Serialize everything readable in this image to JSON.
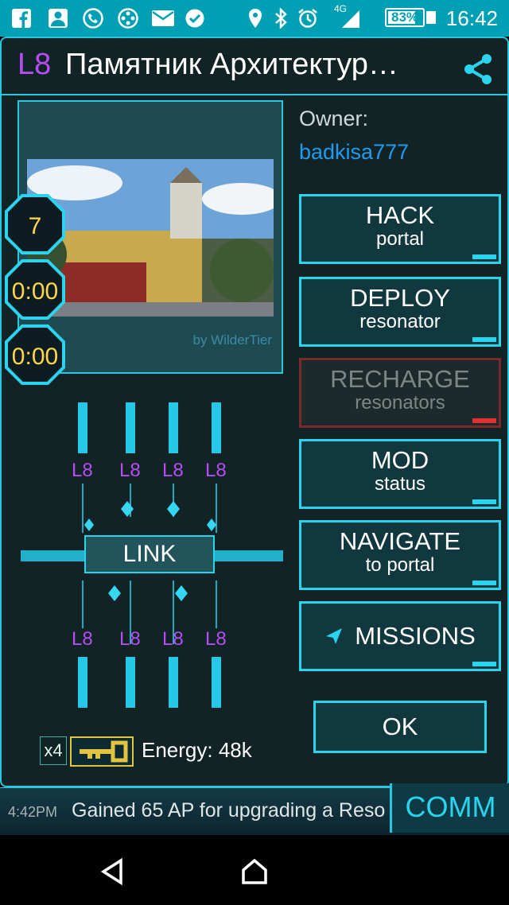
{
  "status_bar": {
    "time": "16:42",
    "battery": "83%",
    "battery_level_percent": 83,
    "network": "4G",
    "icons": [
      "facebook-icon",
      "person-icon",
      "phone-icon",
      "film-icon",
      "mail-icon",
      "check-icon",
      "location-icon",
      "bluetooth-icon",
      "alarm-icon",
      "signal-icon",
      "battery-icon"
    ]
  },
  "portal": {
    "level": "L8",
    "title": "Памятник Архитектур…",
    "owner_label": "Owner:",
    "owner_name": "badkisa777",
    "photo_credit": "by WilderTier",
    "badges": {
      "mods": "7",
      "timer1": "0:00",
      "timer2": "0:00"
    }
  },
  "actions": [
    {
      "line1": "HACK",
      "line2": "portal",
      "enabled": true
    },
    {
      "line1": "DEPLOY",
      "line2": "resonator",
      "enabled": true
    },
    {
      "line1": "RECHARGE",
      "line2": "resonators",
      "enabled": false
    },
    {
      "line1": "MOD",
      "line2": "status",
      "enabled": true
    },
    {
      "line1": "NAVIGATE",
      "line2": "to portal",
      "enabled": true
    },
    {
      "line1": "MISSIONS",
      "line2": "",
      "enabled": true
    }
  ],
  "ok_label": "OK",
  "link_label": "LINK",
  "resonators": [
    "L8",
    "L8",
    "L8",
    "L8",
    "L8",
    "L8",
    "L8",
    "L8"
  ],
  "keys": {
    "count": "x4",
    "energy": "Energy: 48k"
  },
  "comm": {
    "time": "4:42PM",
    "message": "Gained 65 AP for upgrading a Reso",
    "button": "COMM"
  },
  "colors": {
    "accent": "#2ad4ef",
    "level": "#b54df5",
    "owner": "#1f9cf0",
    "disabled": "#e03030",
    "key": "#e2c440"
  }
}
